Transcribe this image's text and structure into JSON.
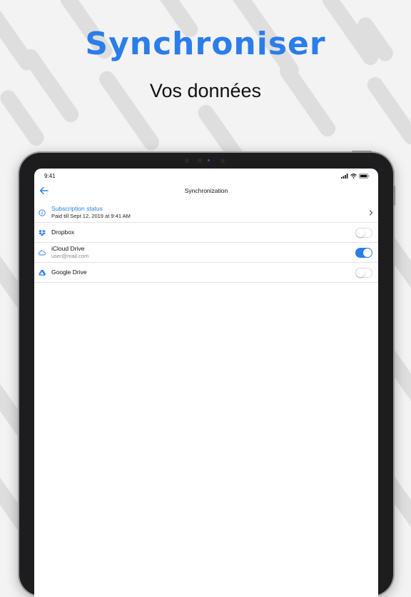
{
  "headline": "Synchroniser",
  "subline": "Vos données",
  "colors": {
    "accent": "#2b7de9",
    "background": "#f3f3f3",
    "device": "#1d1d1f"
  },
  "statusbar": {
    "time": "9:41",
    "icons": [
      "signal-icon",
      "wifi-icon",
      "battery-icon"
    ]
  },
  "navbar": {
    "title": "Synchronization",
    "back_icon": "back-arrow-icon"
  },
  "subscription": {
    "title": "Subscription status",
    "subtitle": "Paid till Sept 12, 2019 at 9:41 AM",
    "icon": "info-icon",
    "trailing_icon": "chevron-right-icon"
  },
  "services": [
    {
      "name": "Dropbox",
      "icon": "dropbox-icon",
      "enabled": false
    },
    {
      "name": "iCloud Drive",
      "account": "user@mail.com",
      "icon": "cloud-icon",
      "enabled": true
    },
    {
      "name": "Google Drive",
      "icon": "google-drive-icon",
      "enabled": false
    }
  ]
}
